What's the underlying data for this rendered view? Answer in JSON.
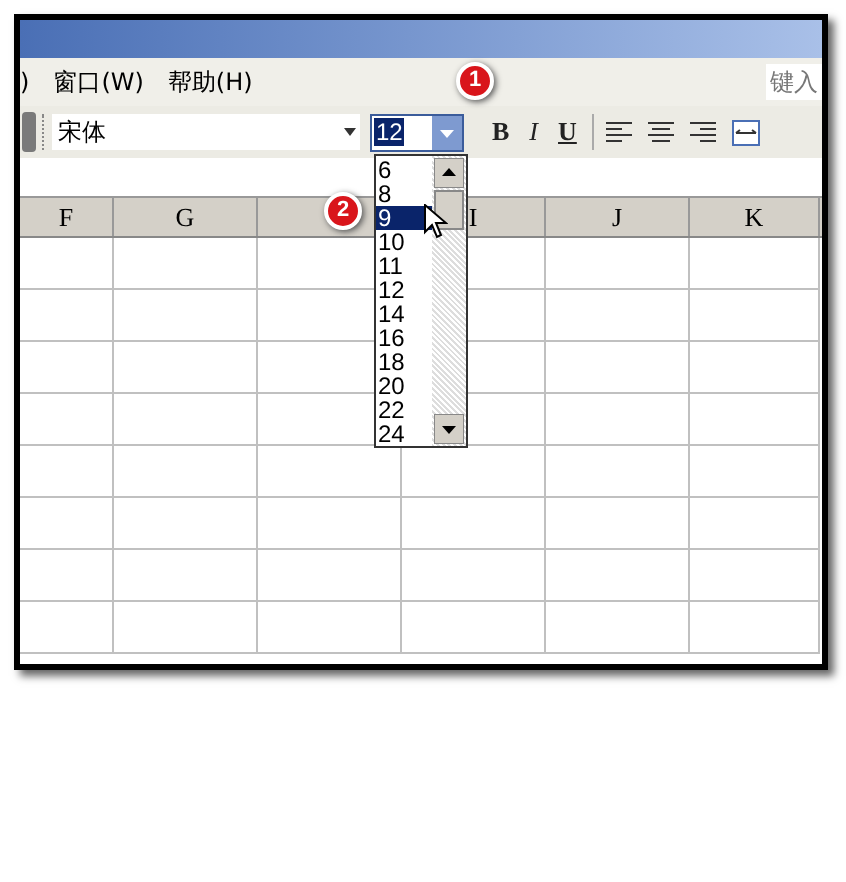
{
  "menu": [
    {
      "label": ")"
    },
    {
      "label": "窗口(W)"
    },
    {
      "label": "帮助(H)"
    }
  ],
  "help_search": {
    "placeholder": "键入"
  },
  "toolbar": {
    "font_name": "宋体",
    "font_size": "12",
    "format_buttons": [
      {
        "label": "B",
        "kind": "bold"
      },
      {
        "label": "I",
        "kind": "italic"
      },
      {
        "label": "U",
        "kind": "underline"
      }
    ]
  },
  "columns": [
    {
      "label": "F"
    },
    {
      "label": "G"
    },
    {},
    {
      "label": "I"
    },
    {
      "label": "J"
    },
    {
      "label": "K"
    }
  ],
  "size_list": {
    "items": [
      {
        "label": "6",
        "selected": false
      },
      {
        "label": "8",
        "selected": false
      },
      {
        "label": "9",
        "selected": true
      },
      {
        "label": "10",
        "selected": false
      },
      {
        "label": "11",
        "selected": false
      },
      {
        "label": "12",
        "selected": false
      },
      {
        "label": "14",
        "selected": false
      },
      {
        "label": "16",
        "selected": false
      },
      {
        "label": "18",
        "selected": false
      },
      {
        "label": "20",
        "selected": false
      },
      {
        "label": "22",
        "selected": false
      },
      {
        "label": "24",
        "selected": false
      }
    ]
  },
  "step_badges": [
    {
      "label": "1"
    },
    {
      "label": "2"
    }
  ]
}
